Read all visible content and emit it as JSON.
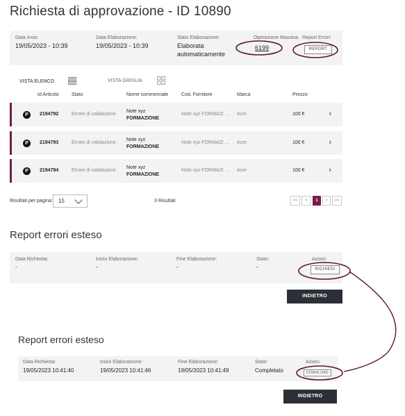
{
  "page_title": "Richiesta di approvazione - ID 10890",
  "summary": {
    "data_invio_label": "Data Invio:",
    "data_invio_value": "19/05/2023 - 10:39",
    "data_elaborazione_label": "Data Elaborazione:",
    "data_elaborazione_value": "19/05/2023 - 10:39",
    "stato_label": "Stato Elaborazione:",
    "stato_value_line1": "Elaborata",
    "stato_value_line2": "automaticamente",
    "operazione_label": "Operazione Massiva:",
    "operazione_value": "6199",
    "report_label": "Report Errori:",
    "report_button": "REPORT"
  },
  "views": {
    "list_label": "VISTA ELENCO",
    "grid_label": "VISTA GRIGLIA"
  },
  "table": {
    "headers": [
      "Id Articolo",
      "Stato",
      "Nome commerciale",
      "Cod. Fornitore",
      "Marca",
      "Prezzo"
    ],
    "rows": [
      {
        "badge": "P",
        "id": "2194792",
        "stato": "Errore di validazione",
        "nome_line1": "Note xyz",
        "nome_line2": "FORMAZIONE",
        "cod": "Note xyz FORMAZI ...",
        "marca": "Acer",
        "prezzo": "100 €",
        "chevron": "›"
      },
      {
        "badge": "P",
        "id": "2194793",
        "stato": "Errore di validazione",
        "nome_line1": "Note xyz",
        "nome_line2": "FORMAZIONE",
        "cod": "Note xyz FORMAZI ...",
        "marca": "Acer",
        "prezzo": "100 €",
        "chevron": "›"
      },
      {
        "badge": "P",
        "id": "2194794",
        "stato": "Errore di validazione",
        "nome_line1": "Note xyz",
        "nome_line2": "FORMAZIONE",
        "cod": "Note xyz FORMAZI ...",
        "marca": "Acer",
        "prezzo": "100 €",
        "chevron": "›"
      }
    ]
  },
  "pagination": {
    "per_page_label": "Risultati per pagina:",
    "per_page_value": "15",
    "results_count": "3 Risultati",
    "first": "<<",
    "prev": "<",
    "current": "1",
    "next": ">",
    "last": ">>"
  },
  "report1": {
    "title": "Report errori esteso",
    "data_richiesta_label": "Data Richiesta:",
    "data_richiesta_value": "-",
    "inizio_label": "Inizio Elaborazione:",
    "inizio_value": "-",
    "fine_label": "Fine Elaborazione:",
    "fine_value": "-",
    "stato_label": "Stato:",
    "stato_value": "-",
    "azioni_label": "Azioni:",
    "action_button": "RICHIEDI",
    "back_button": "INDIETRO"
  },
  "report2": {
    "title": "Report errori esteso",
    "data_richiesta_label": "Data Richiesta:",
    "data_richiesta_value": "19/05/2023 10:41:40",
    "inizio_label": "Inizio Elaborazione:",
    "inizio_value": "19/05/2023 10:41:46",
    "fine_label": "Fine Elaborazione:",
    "fine_value": "19/05/2023 10:41:49",
    "stato_label": "Stato:",
    "stato_value": "Completato",
    "azioni_label": "Azioni:",
    "action_button": "DOWNLOAD",
    "back_button": "INDIETRO"
  },
  "colors": {
    "accent": "#7a1a4c",
    "annotation": "#5e1240",
    "dark_button": "#2b2f36",
    "panel": "#f3f3f3"
  },
  "icons": [
    "list-view-icon",
    "grid-view-icon",
    "chevron-right-icon",
    "chevron-down-icon",
    "product-badge-icon"
  ]
}
